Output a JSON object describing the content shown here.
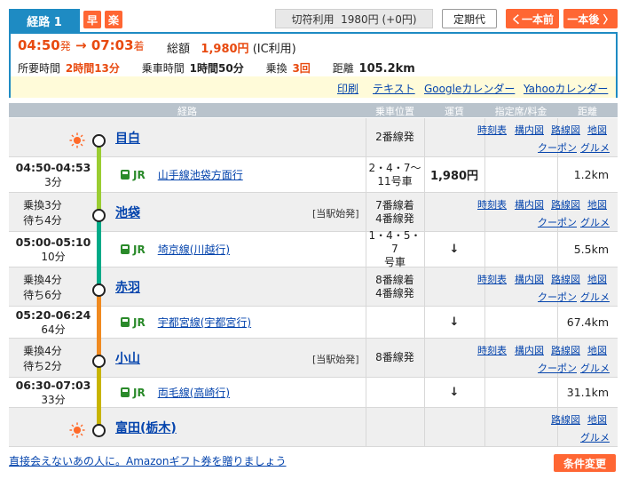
{
  "header": {
    "route_label": "経路 1",
    "badge_fast": "早",
    "badge_easy": "楽",
    "fare_type": "切符利用",
    "fare_value": "1980円 (+0円)",
    "commuter_btn": "定期代",
    "prev_btn": "く一本前",
    "next_btn": "一本後 〉"
  },
  "summary": {
    "dep_time": "04:50",
    "dep_suffix": "発",
    "arrow": "→",
    "arr_time": "07:03",
    "arr_suffix": "着",
    "total_label": "総額",
    "total_value": "1,980円",
    "total_note": "(IC利用)",
    "required_label": "所要時間",
    "required_value": "2時間13分",
    "ride_label": "乗車時間",
    "ride_value": "1時間50分",
    "transfer_label": "乗換",
    "transfer_value": "3回",
    "distance_label": "距離",
    "distance_value": "105.2km"
  },
  "links": {
    "print": "印刷",
    "text": "テキスト",
    "google": "Googleカレンダー",
    "yahoo": "Yahooカレンダー"
  },
  "columns": {
    "route": "経路",
    "position": "乗車位置",
    "fare": "運賃",
    "reserved": "指定席/料金",
    "distance": "距離"
  },
  "station_links": {
    "timetable": "時刻表",
    "premises": "構内図",
    "route_map": "路線図",
    "map": "地図",
    "coupon": "クーポン",
    "gourmet": "グルメ"
  },
  "stations": [
    {
      "name": "目白",
      "left_lines": [],
      "platform": "2番線発",
      "note": ""
    },
    {
      "name": "池袋",
      "left_lines": [
        "乗換3分",
        "待ち4分"
      ],
      "platform": "7番線着\n4番線発",
      "note": "[当駅始発]"
    },
    {
      "name": "赤羽",
      "left_lines": [
        "乗換4分",
        "待ち6分"
      ],
      "platform": "8番線着\n4番線発",
      "note": ""
    },
    {
      "name": "小山",
      "left_lines": [
        "乗換4分",
        "待ち2分"
      ],
      "platform": "8番線発",
      "note": "[当駅始発]"
    },
    {
      "name": "富田(栃木)",
      "left_lines": [],
      "platform": "",
      "note": ""
    }
  ],
  "segments": [
    {
      "time": "04:50-04:53",
      "duration": "3分",
      "company": "JR",
      "line": "山手線池袋方面行",
      "car": "2・4・7～\n11号車",
      "fare": "1,980円",
      "distance": "1.2km",
      "color": "#9acd32"
    },
    {
      "time": "05:00-05:10",
      "duration": "10分",
      "company": "JR",
      "line": "埼京線(川越行)",
      "car": "1・4・5・7\n号車",
      "fare": "↓",
      "distance": "5.5km",
      "color": "#00aa88"
    },
    {
      "time": "05:20-06:24",
      "duration": "64分",
      "company": "JR",
      "line": "宇都宮線(宇都宮行)",
      "car": "",
      "fare": "↓",
      "distance": "67.4km",
      "color": "#f08a20"
    },
    {
      "time": "06:30-07:03",
      "duration": "33分",
      "company": "JR",
      "line": "両毛線(高崎行)",
      "car": "",
      "fare": "↓",
      "distance": "31.1km",
      "color": "#c8b400"
    }
  ],
  "footer": {
    "amazon_link": "直接会えないあの人に。Amazonギフト券を贈りましょう",
    "condition_btn": "条件変更"
  },
  "colors": {
    "accent_blue": "#1e8bc3",
    "accent_orange": "#ff6633",
    "sun": "#ff6a2a"
  }
}
